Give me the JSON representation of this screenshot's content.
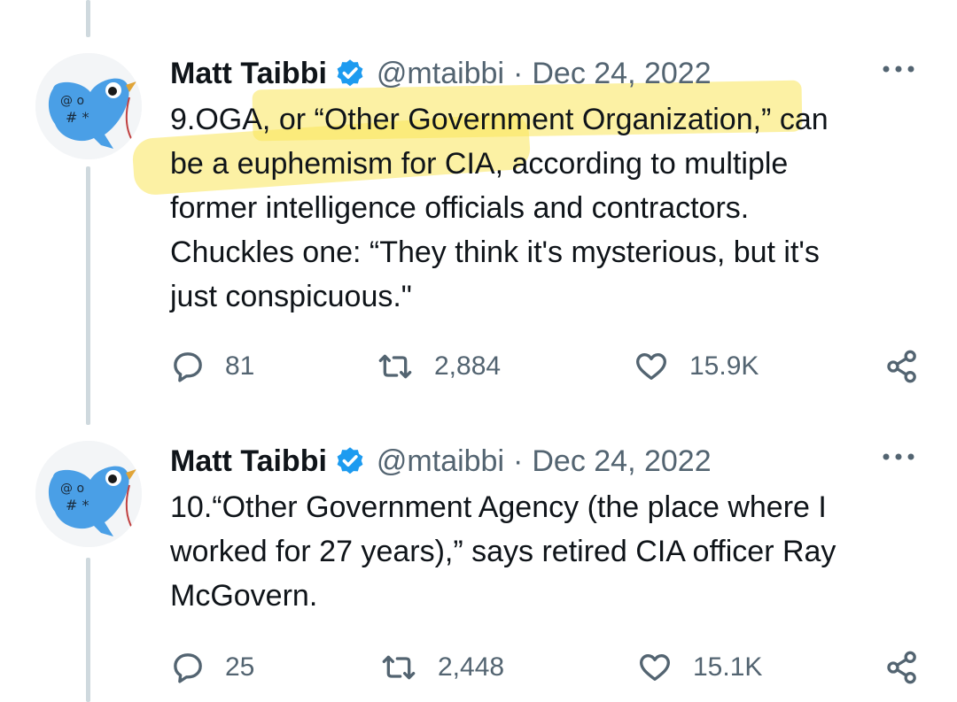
{
  "tweets": [
    {
      "author": "Matt Taibbi",
      "handle": "@mtaibbi",
      "separator": "·",
      "date": "Dec 24, 2022",
      "text_lines": [
        "9.OGA, or “Other Government Organization,” can",
        "be a euphemism for CIA, according to multiple",
        "former intelligence officials and contractors.",
        "Chuckles one: “They think it's mysterious, but it's",
        "just conspicuous.\""
      ],
      "replies": "81",
      "reposts": "2,884",
      "likes": "15.9K"
    },
    {
      "author": "Matt Taibbi",
      "handle": "@mtaibbi",
      "separator": "·",
      "date": "Dec 24, 2022",
      "text_lines": [
        "10.“Other Government Agency (the place where I",
        "worked for 27 years),” says retired CIA officer Ray",
        "McGovern."
      ],
      "replies": "25",
      "reposts": "2,448",
      "likes": "15.1K"
    }
  ],
  "icons": {
    "avatar": "twitter-bird-avatar-icon",
    "verified": "verified-badge-icon",
    "more": "more-options-icon",
    "reply": "reply-icon",
    "repost": "repost-icon",
    "like": "like-icon",
    "share": "share-icon"
  },
  "colors": {
    "verified": "#1d9bf0",
    "secondary_text": "#536471",
    "highlight": "#f6e25a",
    "bird": "#4a9fe6"
  }
}
